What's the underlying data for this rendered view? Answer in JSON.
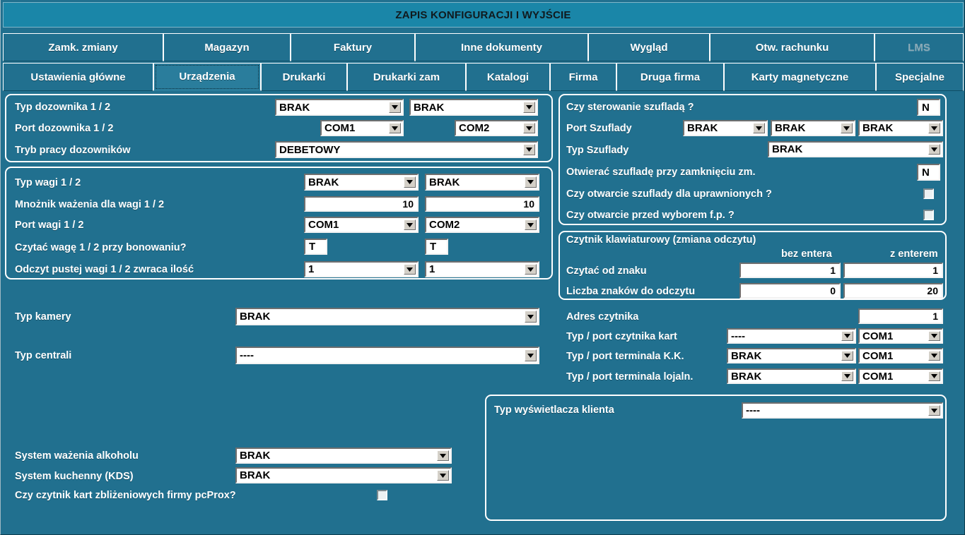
{
  "window": {
    "title": "ZAPIS KONFIGURACJI I WYJŚCIE"
  },
  "tabs_row1": [
    {
      "label": "Zamk. zmiany",
      "disabled": false
    },
    {
      "label": "Magazyn",
      "disabled": false
    },
    {
      "label": "Faktury",
      "disabled": false
    },
    {
      "label": "Inne dokumenty",
      "disabled": false
    },
    {
      "label": "Wygląd",
      "disabled": false
    },
    {
      "label": "Otw. rachunku",
      "disabled": false
    },
    {
      "label": "LMS",
      "disabled": true
    }
  ],
  "tabs_row2": [
    {
      "label": "Ustawienia główne",
      "active": false
    },
    {
      "label": "Urządzenia",
      "active": true
    },
    {
      "label": "Drukarki",
      "active": false
    },
    {
      "label": "Drukarki zam",
      "active": false
    },
    {
      "label": "Katalogi",
      "active": false
    },
    {
      "label": "Firma",
      "active": false
    },
    {
      "label": "Druga firma",
      "active": false
    },
    {
      "label": "Karty magnetyczne",
      "active": false
    },
    {
      "label": "Specjalne",
      "active": false
    }
  ],
  "dispenser_group": {
    "type_label": "Typ dozownika 1 / 2",
    "type_1": "BRAK",
    "type_2": "BRAK",
    "port_label": "Port dozownika 1 / 2",
    "port_1": "COM1",
    "port_2": "COM2",
    "mode_label": "Tryb pracy dozowników",
    "mode": "DEBETOWY"
  },
  "scale_group": {
    "type_label": "Typ wagi 1 / 2",
    "type_1": "BRAK",
    "type_2": "BRAK",
    "multiplier_label": "Mnożnik ważenia dla wagi 1 / 2",
    "multiplier_1": "10",
    "multiplier_2": "10",
    "port_label": "Port wagi 1 / 2",
    "port_1": "COM1",
    "port_2": "COM2",
    "read_label": "Czytać wagę 1 / 2 przy bonowaniu?",
    "read_1": "T",
    "read_2": "T",
    "empty_label": "Odczyt pustej wagi 1 / 2 zwraca ilość",
    "empty_1": "1",
    "empty_2": "1"
  },
  "camera": {
    "label": "Typ kamery",
    "value": "BRAK"
  },
  "central": {
    "label": "Typ centrali",
    "value": "----"
  },
  "alcohol": {
    "label": "System ważenia alkoholu",
    "value": "BRAK"
  },
  "kds": {
    "label": "System kuchenny (KDS)",
    "value": "BRAK"
  },
  "pcprox": {
    "label": "Czy czytnik kart zbliżeniowych firmy pcProx?",
    "checked": false
  },
  "drawer_group": {
    "control_label": "Czy sterowanie szufladą ?",
    "control_value": "N",
    "port_label": "Port Szuflady",
    "port_1": "BRAK",
    "port_2": "BRAK",
    "port_3": "BRAK",
    "type_label": "Typ Szuflady",
    "type_value": "BRAK",
    "open_close_label": "Otwierać szufladę przy zamknięciu zm.",
    "open_close_value": "N",
    "authorized_label": "Czy otwarcie szuflady dla uprawnionych ?",
    "authorized_checked": false,
    "before_fp_label": "Czy otwarcie przed wyborem f.p. ?",
    "before_fp_checked": false
  },
  "keyboard_reader_group": {
    "title": "Czytnik klawiaturowy (zmiana odczytu)",
    "col1_header": "bez entera",
    "col2_header": "z enterem",
    "from_char_label": "Czytać od znaku",
    "from_char_1": "1",
    "from_char_2": "1",
    "count_label": "Liczba znaków do odczytu",
    "count_1": "0",
    "count_2": "20"
  },
  "reader": {
    "address_label": "Adres czytnika",
    "address_value": "1",
    "card_reader_label": "Typ / port czytnika kart",
    "card_reader_type": "----",
    "card_reader_port": "COM1",
    "kk_terminal_label": "Typ / port terminala K.K.",
    "kk_terminal_type": "BRAK",
    "kk_terminal_port": "COM1",
    "loyalty_terminal_label": "Typ / port terminala lojaln.",
    "loyalty_terminal_type": "BRAK",
    "loyalty_terminal_port": "COM1"
  },
  "customer_display_group": {
    "label": "Typ wyświetlacza klienta",
    "value": "----"
  },
  "colors": {
    "background": "#21708f",
    "titlebar": "#1a86a8",
    "tab_active": "#2a7d9c",
    "border_white": "#ffffff",
    "field_bg": "#ffffff",
    "disabled_text": "#8aa9b6"
  }
}
